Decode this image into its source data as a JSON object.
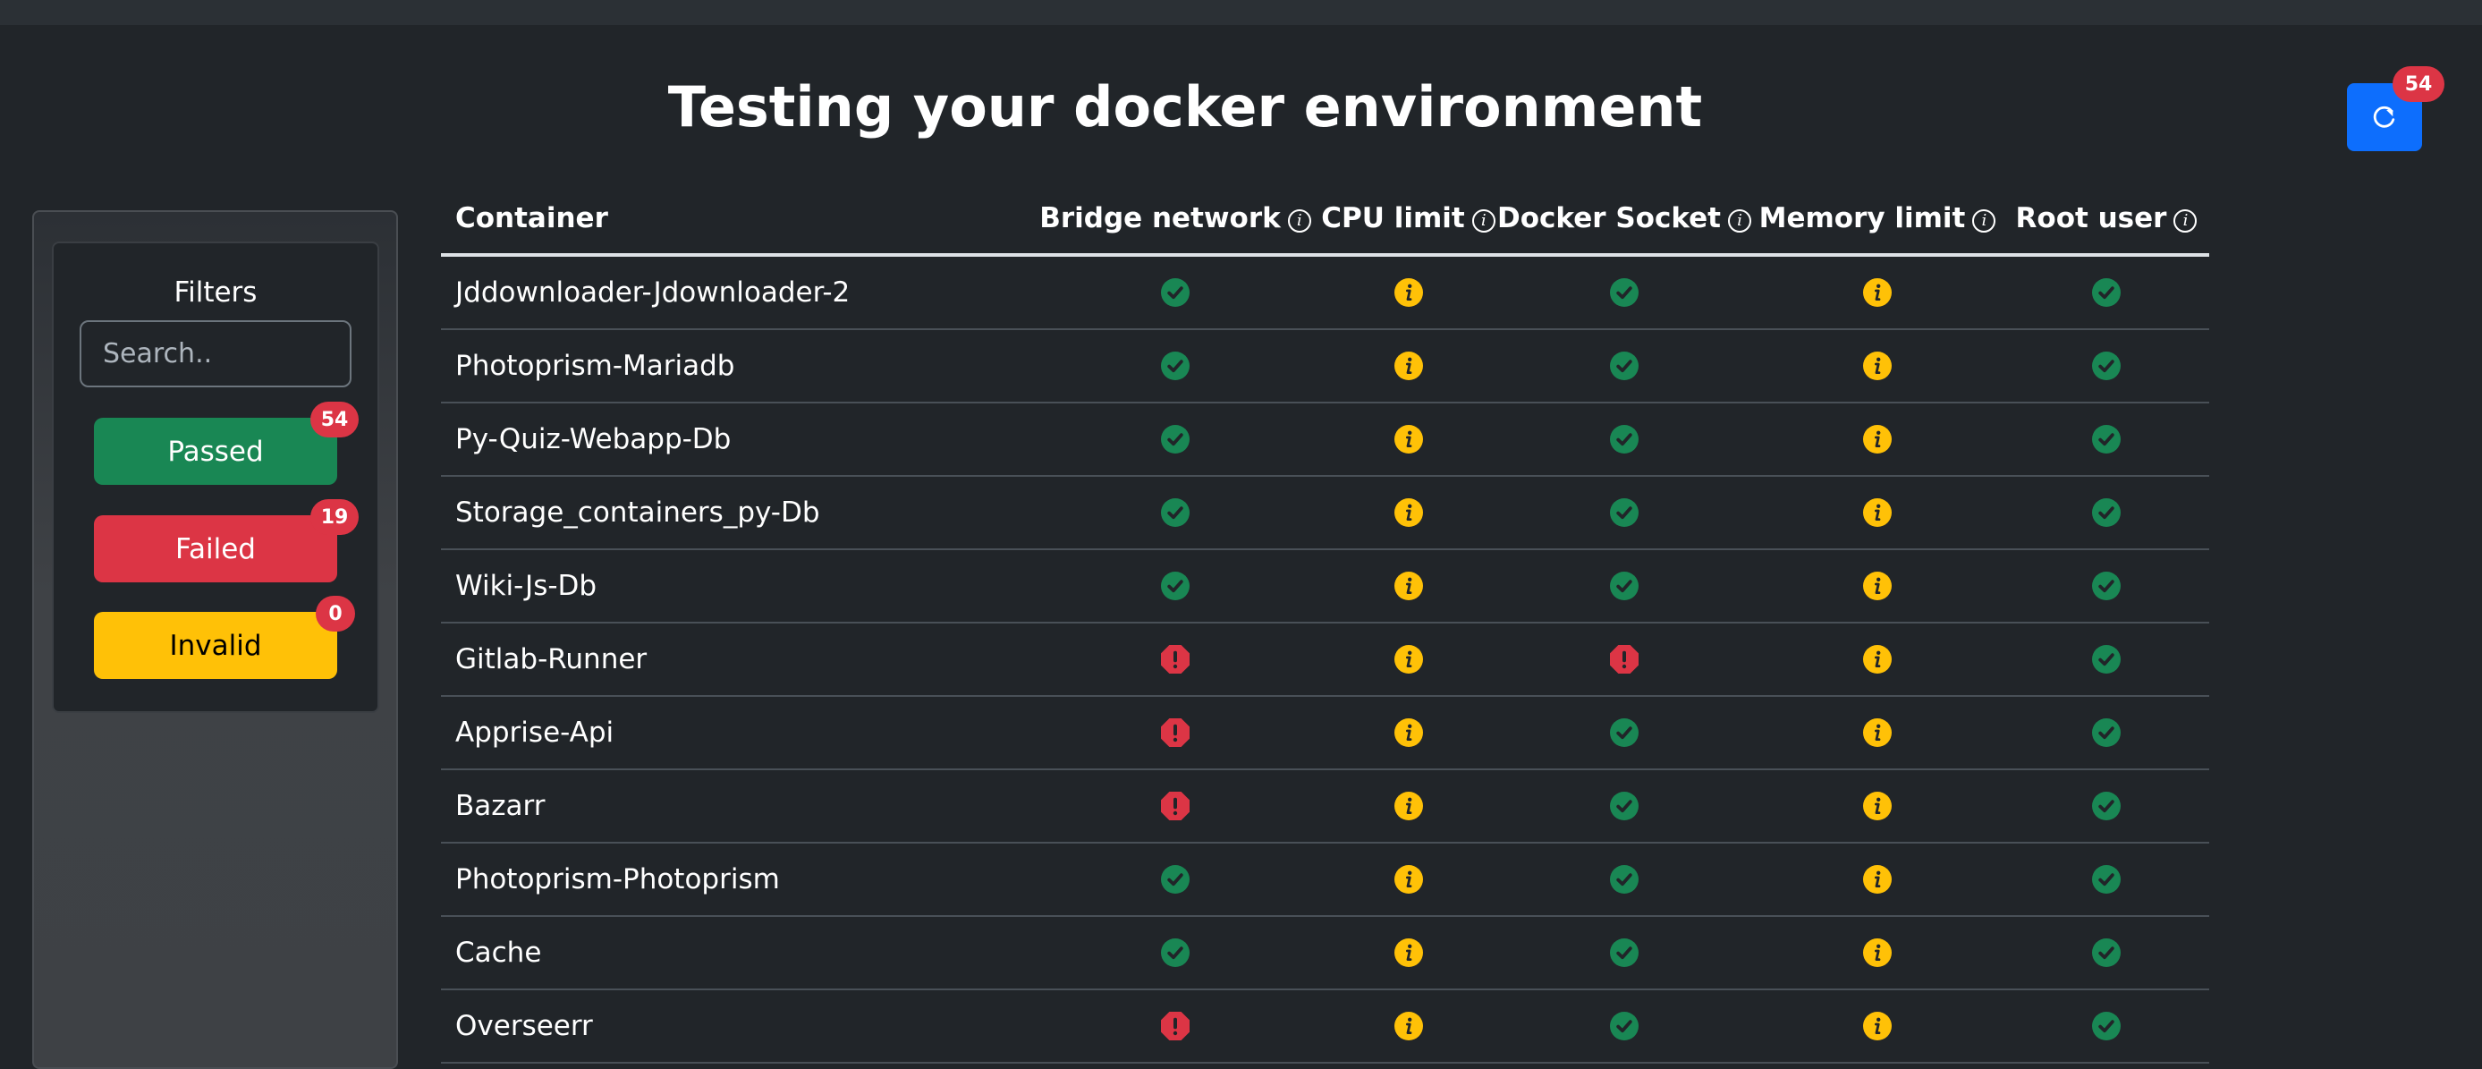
{
  "page": {
    "title": "Testing your docker environment"
  },
  "toolbar": {
    "refresh_count": "54",
    "refresh_icon": "refresh-icon"
  },
  "filters": {
    "heading": "Filters",
    "search_placeholder": "Search..",
    "passed": {
      "label": "Passed",
      "count": "54",
      "color": "#198754"
    },
    "failed": {
      "label": "Failed",
      "count": "19",
      "color": "#dc3545"
    },
    "invalid": {
      "label": "Invalid",
      "count": "0",
      "color": "#ffc107"
    }
  },
  "table": {
    "columns": [
      "Container",
      "Bridge network",
      "CPU limit",
      "Docker Socket",
      "Memory limit",
      "Root user"
    ],
    "status_colors": {
      "pass": "#198754",
      "fail": "#dc3545",
      "info": "#ffc107"
    },
    "rows": [
      {
        "name": "Jddownloader-Jdownloader-2",
        "status": [
          "pass",
          "info",
          "pass",
          "info",
          "pass"
        ]
      },
      {
        "name": "Photoprism-Mariadb",
        "status": [
          "pass",
          "info",
          "pass",
          "info",
          "pass"
        ]
      },
      {
        "name": "Py-Quiz-Webapp-Db",
        "status": [
          "pass",
          "info",
          "pass",
          "info",
          "pass"
        ]
      },
      {
        "name": "Storage_containers_py-Db",
        "status": [
          "pass",
          "info",
          "pass",
          "info",
          "pass"
        ]
      },
      {
        "name": "Wiki-Js-Db",
        "status": [
          "pass",
          "info",
          "pass",
          "info",
          "pass"
        ]
      },
      {
        "name": "Gitlab-Runner",
        "status": [
          "fail",
          "info",
          "fail",
          "info",
          "pass"
        ]
      },
      {
        "name": "Apprise-Api",
        "status": [
          "fail",
          "info",
          "pass",
          "info",
          "pass"
        ]
      },
      {
        "name": "Bazarr",
        "status": [
          "fail",
          "info",
          "pass",
          "info",
          "pass"
        ]
      },
      {
        "name": "Photoprism-Photoprism",
        "status": [
          "pass",
          "info",
          "pass",
          "info",
          "pass"
        ]
      },
      {
        "name": "Cache",
        "status": [
          "pass",
          "info",
          "pass",
          "info",
          "pass"
        ]
      },
      {
        "name": "Overseerr",
        "status": [
          "fail",
          "info",
          "pass",
          "info",
          "pass"
        ]
      }
    ]
  }
}
